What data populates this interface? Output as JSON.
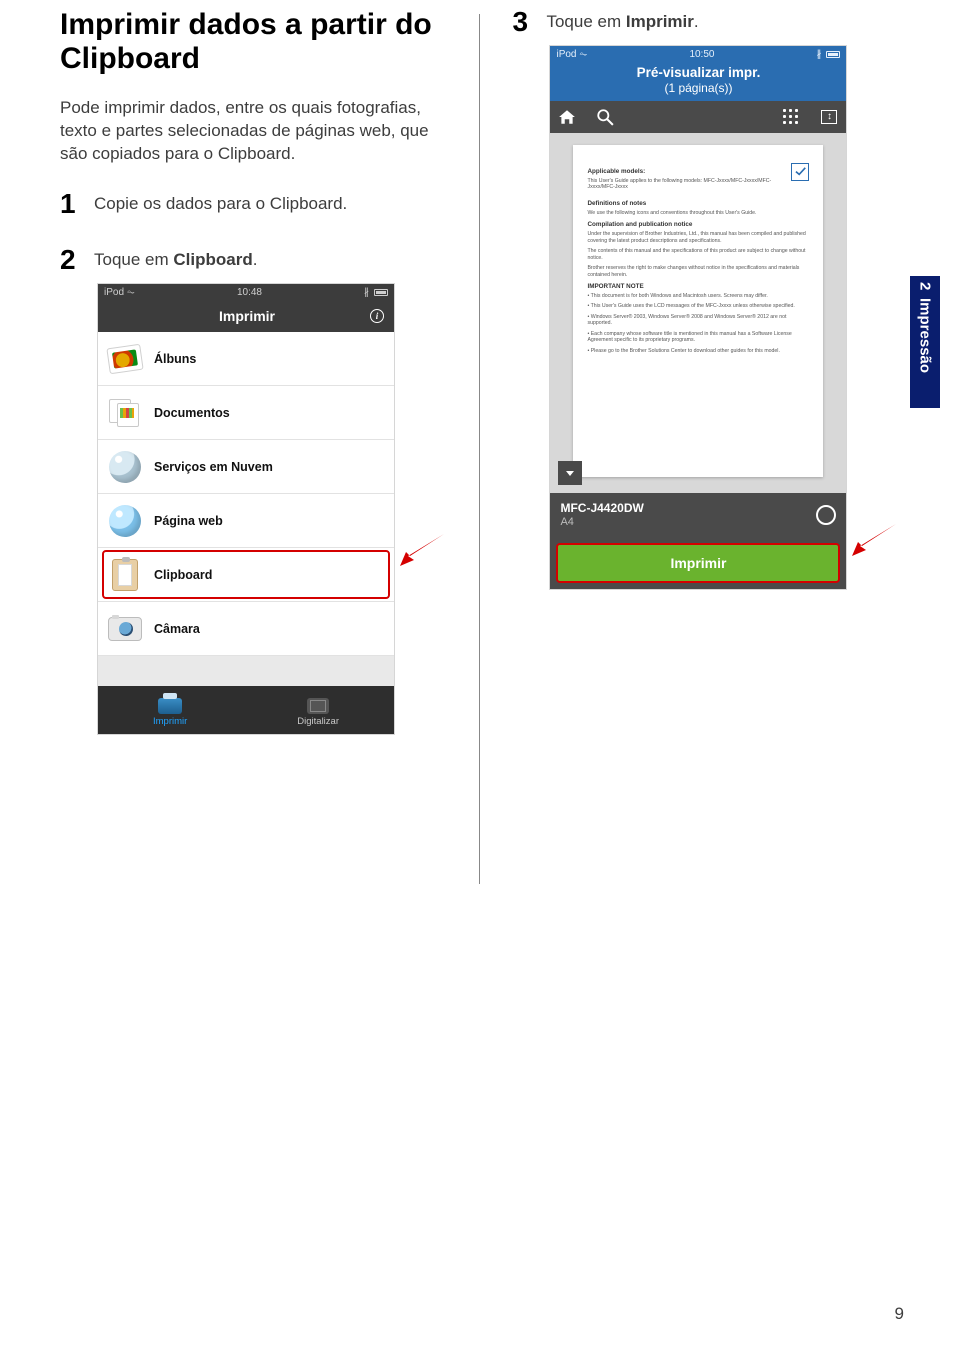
{
  "section": {
    "title": "Imprimir dados a partir do Clipboard",
    "intro": "Pode imprimir dados, entre os quais fotografias, texto e partes selecionadas de páginas web, que são copiados para o Clipboard."
  },
  "steps": {
    "s1_num": "1",
    "s1_text": "Copie os dados para o Clipboard.",
    "s2_num": "2",
    "s2_prefix": "Toque em ",
    "s2_bold": "Clipboard",
    "s2_suffix": ".",
    "s3_num": "3",
    "s3_prefix": "Toque em ",
    "s3_bold": "Imprimir",
    "s3_suffix": "."
  },
  "sideTab": {
    "num": "2",
    "label": "Impressão"
  },
  "pageNumber": "9",
  "phone1": {
    "status_left": "iPod",
    "status_time": "10:48",
    "header_title": "Imprimir",
    "menu": {
      "albums": "Álbuns",
      "documents": "Documentos",
      "cloud": "Serviços em Nuvem",
      "webpage": "Página web",
      "clipboard": "Clipboard",
      "camera": "Câmara"
    },
    "tabs": {
      "print": "Imprimir",
      "scan": "Digitalizar"
    }
  },
  "phone2": {
    "status_left": "iPod",
    "status_time": "10:50",
    "header_line1": "Pré-visualizar impr.",
    "header_line2": "(1 página(s))",
    "printer": "MFC-J4420DW",
    "paper": "A4",
    "print_button": "Imprimir",
    "doc": {
      "h1": "",
      "applicable": "Applicable models:",
      "applicable_line": "This User's Guide applies to the following models: MFC-Jxxxx/MFC-Jxxxx/MFC-Jxxxx/MFC-Jxxxx",
      "definitions_h": "Definitions of notes",
      "definitions_line": "We use the following icons and conventions throughout this User's Guide.",
      "compilation_h": "Compilation and publication notice",
      "compilation_l1": "Under the supervision of Brother Industries, Ltd., this manual has been compiled and published covering the latest product descriptions and specifications.",
      "compilation_l2": "The contents of this manual and the specifications of this product are subject to change without notice.",
      "compilation_l3": "Brother reserves the right to make changes without notice in the specifications and materials contained herein.",
      "important_h": "IMPORTANT NOTE",
      "important_l1": "• This document is for both Windows and Macintosh users. Screens may differ.",
      "important_l2": "• This User's Guide uses the LCD messages of the MFC-Jxxxx unless otherwise specified.",
      "important_l3": "• Windows Server® 2003, Windows Server® 2008 and Windows Server® 2012 are not supported.",
      "important_l4": "• Each company whose software title is mentioned in this manual has a Software License Agreement specific to its proprietary programs.",
      "important_l5": "• Please go to the Brother Solutions Center to download other guides for this model."
    }
  }
}
